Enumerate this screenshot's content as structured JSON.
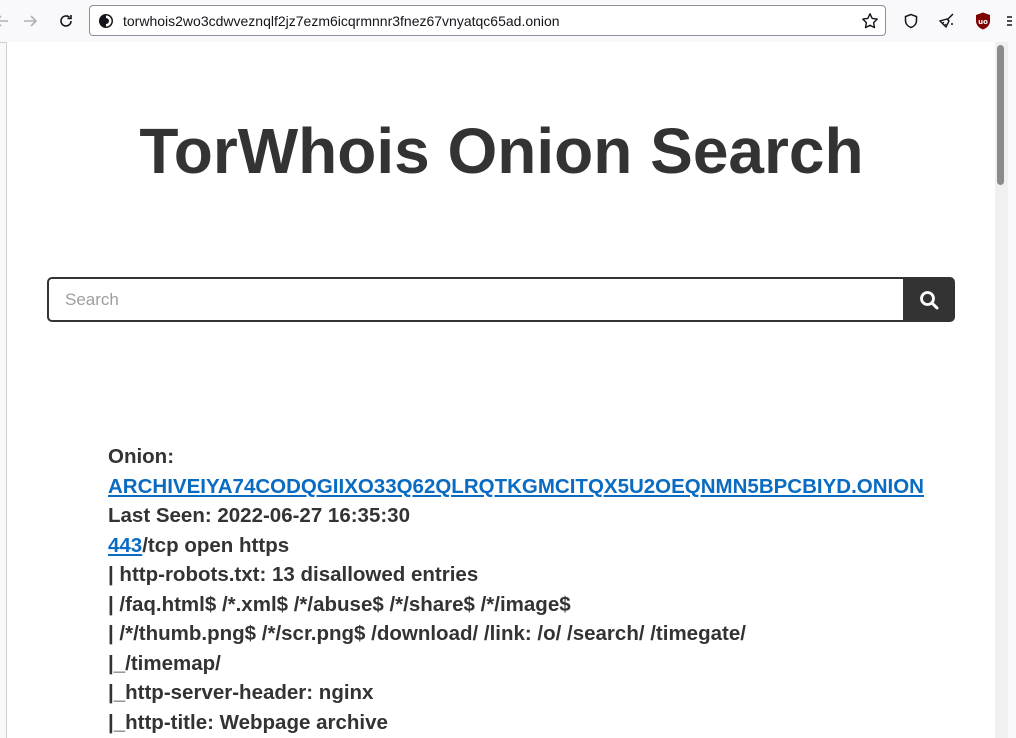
{
  "browser": {
    "url": "torwhois2wo3cdwveznqlf2jz7ezm6icqrmnnr3fnez67vnyatqc65ad.onion",
    "accent": "#15141a"
  },
  "page": {
    "title": "TorWhois Onion Search",
    "search": {
      "placeholder": "Search",
      "value": ""
    },
    "result": {
      "onion_label": "Onion:",
      "onion_address": "ARCHIVEIYA74CODQGIIXO33Q62QLRQTKGMCITQX5U2OEQNMN5BPCBIYD.ONION",
      "last_seen": "Last Seen: 2022-06-27 16:35:30",
      "port_link": "443",
      "port_rest": "/tcp open https",
      "scan_lines": [
        "| http-robots.txt: 13 disallowed entries",
        "| /faq.html$ /*.xml$ /*/abuse$ /*/share$ /*/image$",
        "| /*/thumb.png$ /*/scr.png$ /download/ /link: /o/ /search/ /timegate/",
        "|_/timemap/",
        "|_http-server-header: nginx",
        "|_http-title: Webpage archive"
      ]
    },
    "colors": {
      "text": "#333333",
      "link": "#0a6bc2",
      "button_bg": "#333333"
    }
  }
}
